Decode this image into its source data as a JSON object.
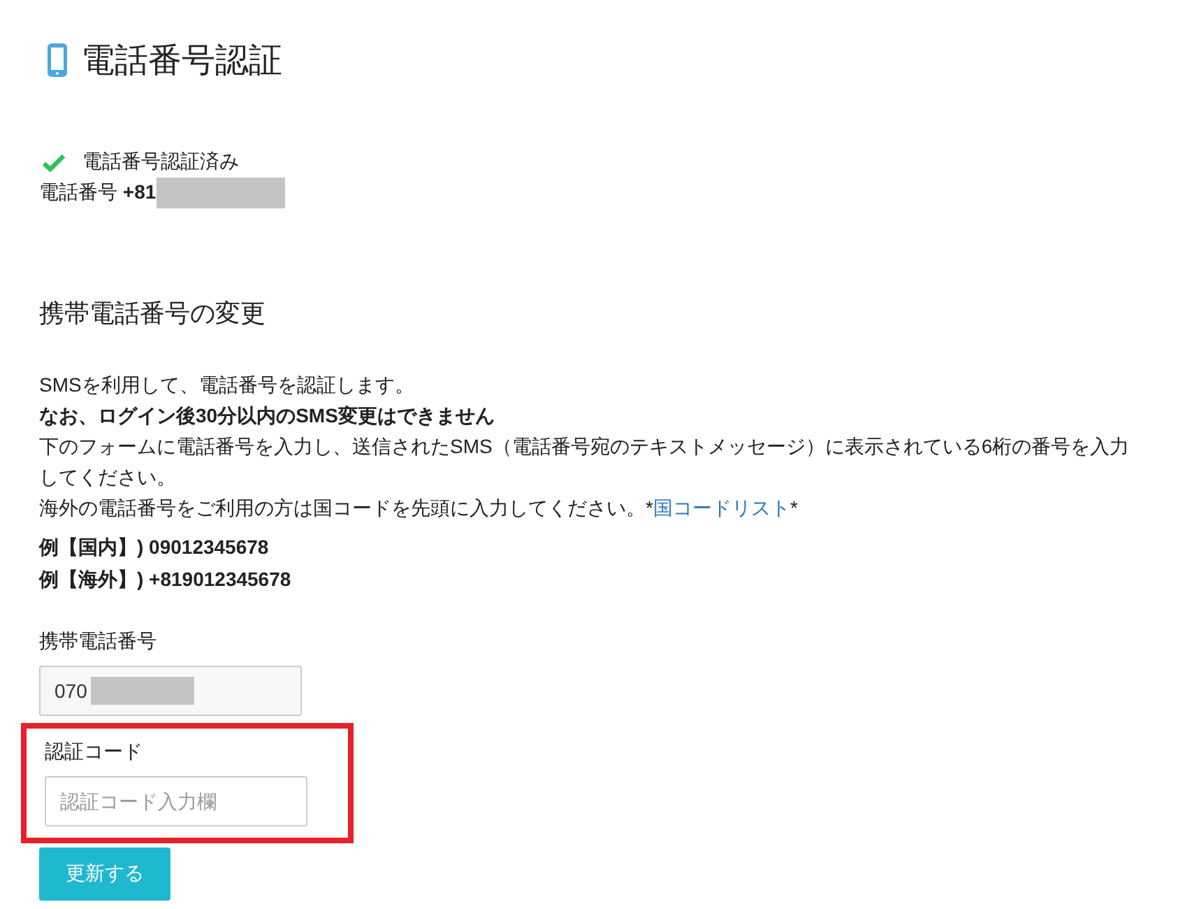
{
  "page_title": "電話番号認証",
  "status": {
    "verified": true,
    "label": "電話番号認証済み",
    "phone": "電話番号 **+81**",
    "phone_redacted": true
  },
  "section": {
    "heading": "携帯電話番号の変更",
    "lines": [
      {
        "kind": "plain",
        "text": "SMSを利用して、電話番号を認証します。"
      },
      {
        "kind": "bold",
        "text": "なお、ログイン後30分以内のSMS変更はできません"
      },
      {
        "kind": "plain",
        "text": "下のフォームに電話番号を入力し、送信されたSMS（電話番号宛のテキストメッセージ）に表示されている6桁の番号を入力してください。"
      },
      {
        "kind": "link",
        "text": "海外の電話番号をご利用の方は国コードを先頭に入力してください。*",
        "link": "国コードリスト",
        "after": "*"
      }
    ],
    "examples": [
      "例【国内】) 09012345678",
      "例【海外】) +819012345678"
    ]
  },
  "phone_field": {
    "label": "携帯電話番号",
    "value": "070",
    "redacted": true
  },
  "code_field": {
    "label": "認証コード",
    "placeholder": "認証コード入力欄",
    "highlighted": true
  },
  "submit": {
    "label": "更新する"
  }
}
